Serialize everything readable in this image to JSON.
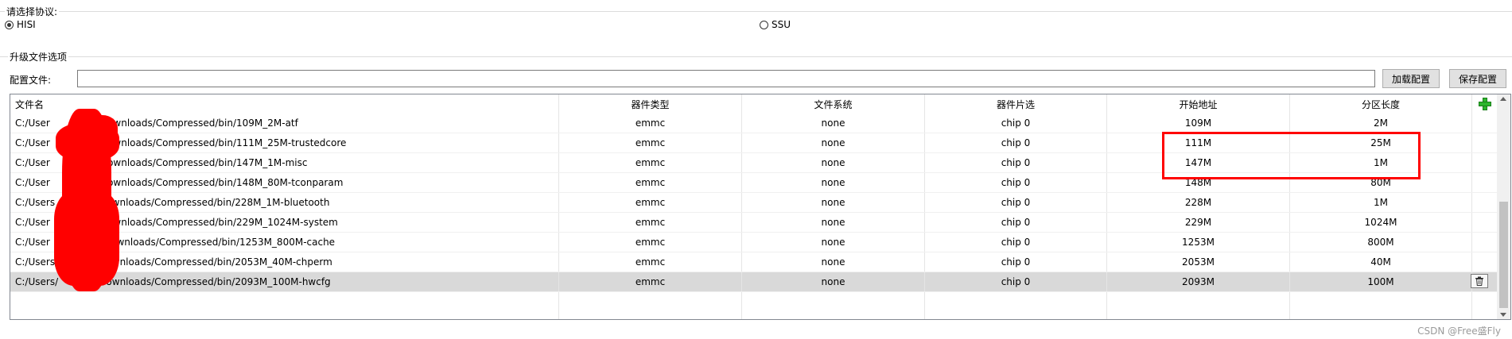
{
  "protocol_group": {
    "title": "请选择协议:",
    "options": [
      {
        "label": "HISI",
        "checked": true
      },
      {
        "label": "SSU",
        "checked": false
      }
    ]
  },
  "upgrade_group": {
    "title": "升级文件选项",
    "config_label": "配置文件:",
    "config_value": "",
    "load_button": "加载配置",
    "save_button": "保存配置"
  },
  "table": {
    "columns": [
      "文件名",
      "器件类型",
      "文件系统",
      "器件片选",
      "开始地址",
      "分区长度"
    ],
    "rows": [
      {
        "file": "C:/User",
        "file_tail": "Downloads/Compressed/bin/109M_2M-atf",
        "type": "emmc",
        "fs": "none",
        "chip": "chip 0",
        "start": "109M",
        "length": "2M"
      },
      {
        "file": "C:/User",
        "file_tail": "Downloads/Compressed/bin/111M_25M-trustedcore",
        "type": "emmc",
        "fs": "none",
        "chip": "chip 0",
        "start": "111M",
        "length": "25M"
      },
      {
        "file": "C:/User",
        "file_tail": "Downloads/Compressed/bin/147M_1M-misc",
        "type": "emmc",
        "fs": "none",
        "chip": "chip 0",
        "start": "147M",
        "length": "1M"
      },
      {
        "file": "C:/User",
        "file_tail": "Downloads/Compressed/bin/148M_80M-tconparam",
        "type": "emmc",
        "fs": "none",
        "chip": "chip 0",
        "start": "148M",
        "length": "80M"
      },
      {
        "file": "C:/Users",
        "file_tail": "Downloads/Compressed/bin/228M_1M-bluetooth",
        "type": "emmc",
        "fs": "none",
        "chip": "chip 0",
        "start": "228M",
        "length": "1M"
      },
      {
        "file": "C:/User",
        "file_tail": "Downloads/Compressed/bin/229M_1024M-system",
        "type": "emmc",
        "fs": "none",
        "chip": "chip 0",
        "start": "229M",
        "length": "1024M"
      },
      {
        "file": "C:/User",
        "file_tail": "/Downloads/Compressed/bin/1253M_800M-cache",
        "type": "emmc",
        "fs": "none",
        "chip": "chip 0",
        "start": "1253M",
        "length": "800M"
      },
      {
        "file": "C:/Users/",
        "file_tail": "/Downloads/Compressed/bin/2053M_40M-chperm",
        "type": "emmc",
        "fs": "none",
        "chip": "chip 0",
        "start": "2053M",
        "length": "40M"
      },
      {
        "file": "C:/Users/",
        "file_tail": "/Downloads/Compressed/bin/2093M_100M-hwcfg",
        "type": "emmc",
        "fs": "none",
        "chip": "chip 0",
        "start": "2093M",
        "length": "100M"
      }
    ],
    "selected_row": 8
  },
  "colors": {
    "highlight": "#ff0000",
    "add_icon": "#2db52d",
    "selected_row": "#d9d9d9"
  },
  "icons": {
    "add": "plus-icon",
    "delete": "trash-icon"
  },
  "watermark": "CSDN @Free盛Fly"
}
